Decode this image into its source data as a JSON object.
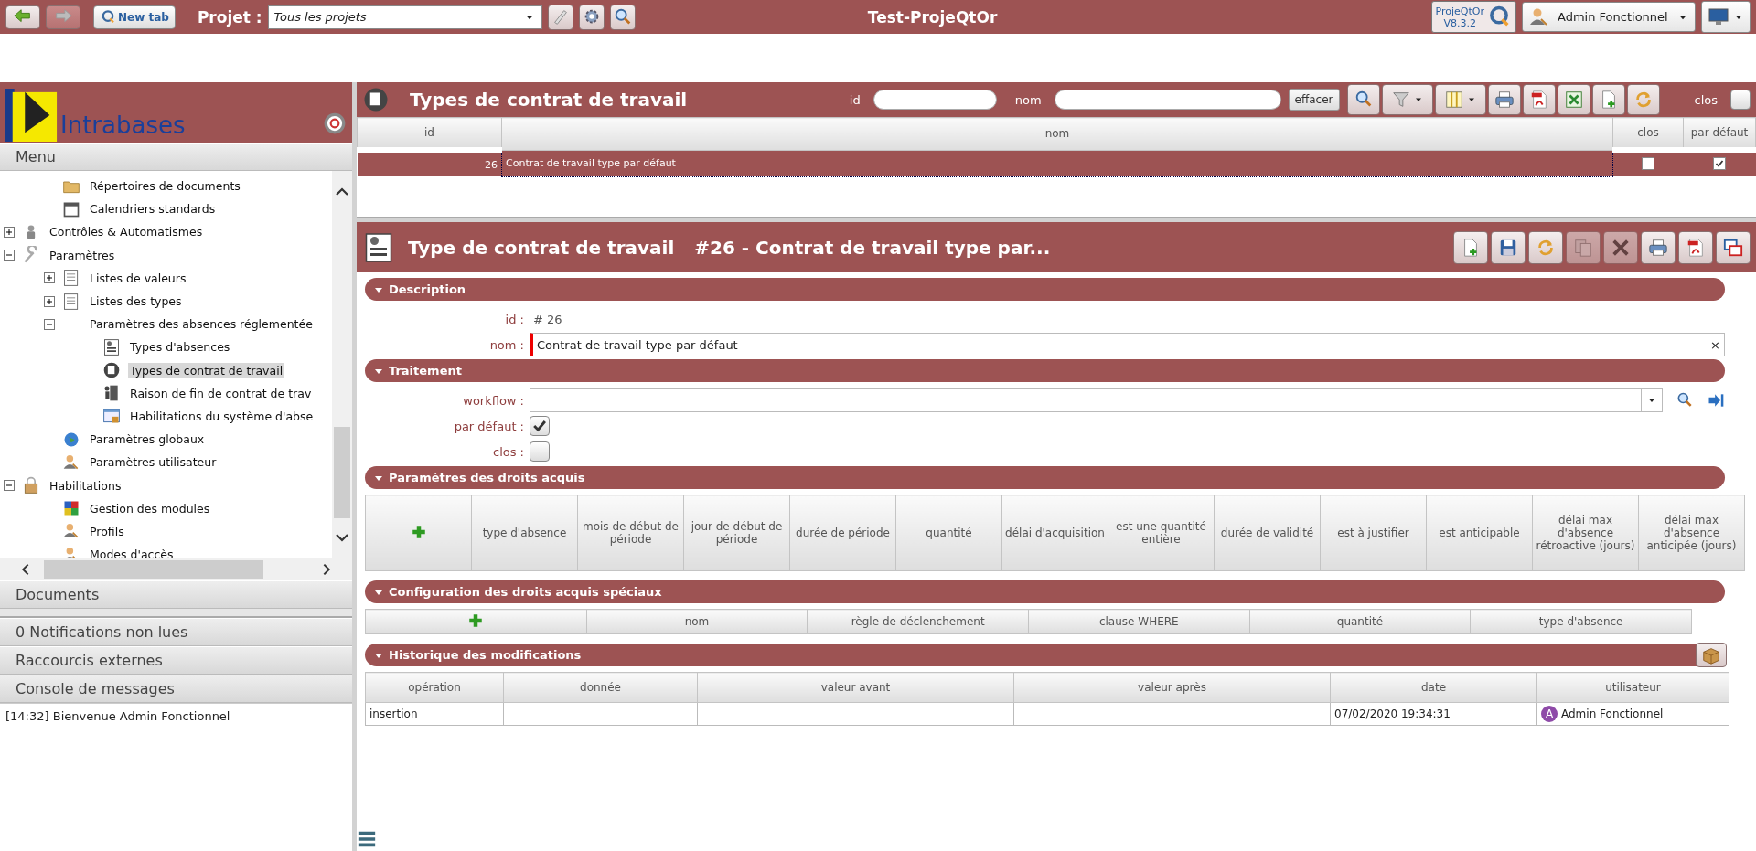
{
  "top_bar": {
    "new_tab": "New tab",
    "project_label": "Projet :",
    "project_value": "Tous les projets",
    "app_title": "Test-ProjeQtOr",
    "product": "ProjeQtOr",
    "version": "V8.3.2",
    "user": "Admin Fonctionnel"
  },
  "sidebar": {
    "logo_text": "Intrabases",
    "menu_title": "Menu",
    "tree": [
      {
        "children": [
          {
            "label": "Répertoires de documents",
            "kind": "folder",
            "selected": false
          },
          {
            "label": "Calendriers standards",
            "kind": "calendar",
            "selected": false
          }
        ]
      },
      {
        "label": "Contrôles & Automatismes",
        "kind": "robot",
        "expanded": false,
        "selected": false
      },
      {
        "label": "Paramètres",
        "kind": "wrench",
        "expanded": true,
        "selected": false,
        "children": [
          {
            "label": "Listes de valeurs",
            "kind": "list",
            "expanded": false,
            "selected": false
          },
          {
            "label": "Listes des types",
            "kind": "list",
            "expanded": false,
            "selected": false
          },
          {
            "label": "Paramètres des absences réglementée",
            "kind": "none",
            "expanded": true,
            "selected": false,
            "children": [
              {
                "label": "Types d'absences",
                "kind": "form",
                "selected": false
              },
              {
                "label": "Types de contrat de travail",
                "kind": "contract",
                "selected": true
              },
              {
                "label": "Raison de fin de contrat de trav",
                "kind": "door",
                "selected": false
              },
              {
                "label": "Habilitations du système d'abse",
                "kind": "window",
                "selected": false
              }
            ]
          },
          {
            "label": "Paramètres globaux",
            "kind": "globe",
            "selected": false
          },
          {
            "label": "Paramètres utilisateur",
            "kind": "user",
            "selected": false
          }
        ]
      },
      {
        "label": "Habilitations",
        "kind": "lock",
        "expanded": true,
        "selected": false,
        "children": [
          {
            "label": "Gestion des modules",
            "kind": "puzzle",
            "selected": false
          },
          {
            "label": "Profils",
            "kind": "user",
            "selected": false
          },
          {
            "label": "Modes d'accès",
            "kind": "user",
            "selected": false
          }
        ]
      }
    ],
    "panels": [
      "Documents",
      "0 Notifications non lues",
      "Raccourcis externes",
      "Console de messages"
    ],
    "messages": [
      "[14:32] Bienvenue Admin Fonctionnel"
    ]
  },
  "list": {
    "title": "Types de contrat de travail",
    "id_label": "id",
    "nom_label": "nom",
    "clear_button": "effacer",
    "clos_label": "clos",
    "clos_checked": false,
    "columns": [
      "id",
      "nom",
      "clos",
      "par défaut"
    ],
    "rows": [
      {
        "id": "26",
        "nom": "Contrat de travail type par défaut",
        "clos": false,
        "par_defaut": true,
        "selected": true
      }
    ]
  },
  "detail": {
    "title": "Type de contrat de travail",
    "reference": "#26 - Contrat de travail type par...",
    "description": {
      "title": "Description",
      "id_label": "id :",
      "id_value": "# 26",
      "nom_label": "nom :",
      "nom_value": "Contrat de travail type par défaut",
      "clear": "×"
    },
    "traitement": {
      "title": "Traitement",
      "workflow_label": "workflow :",
      "par_defaut_label": "par défaut :",
      "par_defaut_checked": true,
      "clos_label": "clos :",
      "clos_checked": false
    },
    "droits": {
      "title": "Paramètres des droits acquis",
      "columns": [
        "type d'absence",
        "mois de début de période",
        "jour de début de période",
        "durée de période",
        "quantité",
        "délai d'acquisition",
        "est une quantité entière",
        "durée de validité",
        "est à justifier",
        "est anticipable",
        "délai max d'absence rétroactive (jours)",
        "délai max d'absence anticipée (jours)"
      ]
    },
    "speciaux": {
      "title": "Configuration des droits acquis spéciaux",
      "columns": [
        "nom",
        "règle de déclenchement",
        "clause WHERE",
        "quantité",
        "type d'absence"
      ]
    },
    "historique": {
      "title": "Historique des modifications",
      "columns": [
        "opération",
        "donnée",
        "valeur avant",
        "valeur après",
        "date",
        "utilisateur"
      ],
      "rows": [
        {
          "operation": "insertion",
          "date": "07/02/2020 19:34:31",
          "user": "Admin Fonctionnel",
          "user_initial": "A"
        }
      ]
    }
  }
}
